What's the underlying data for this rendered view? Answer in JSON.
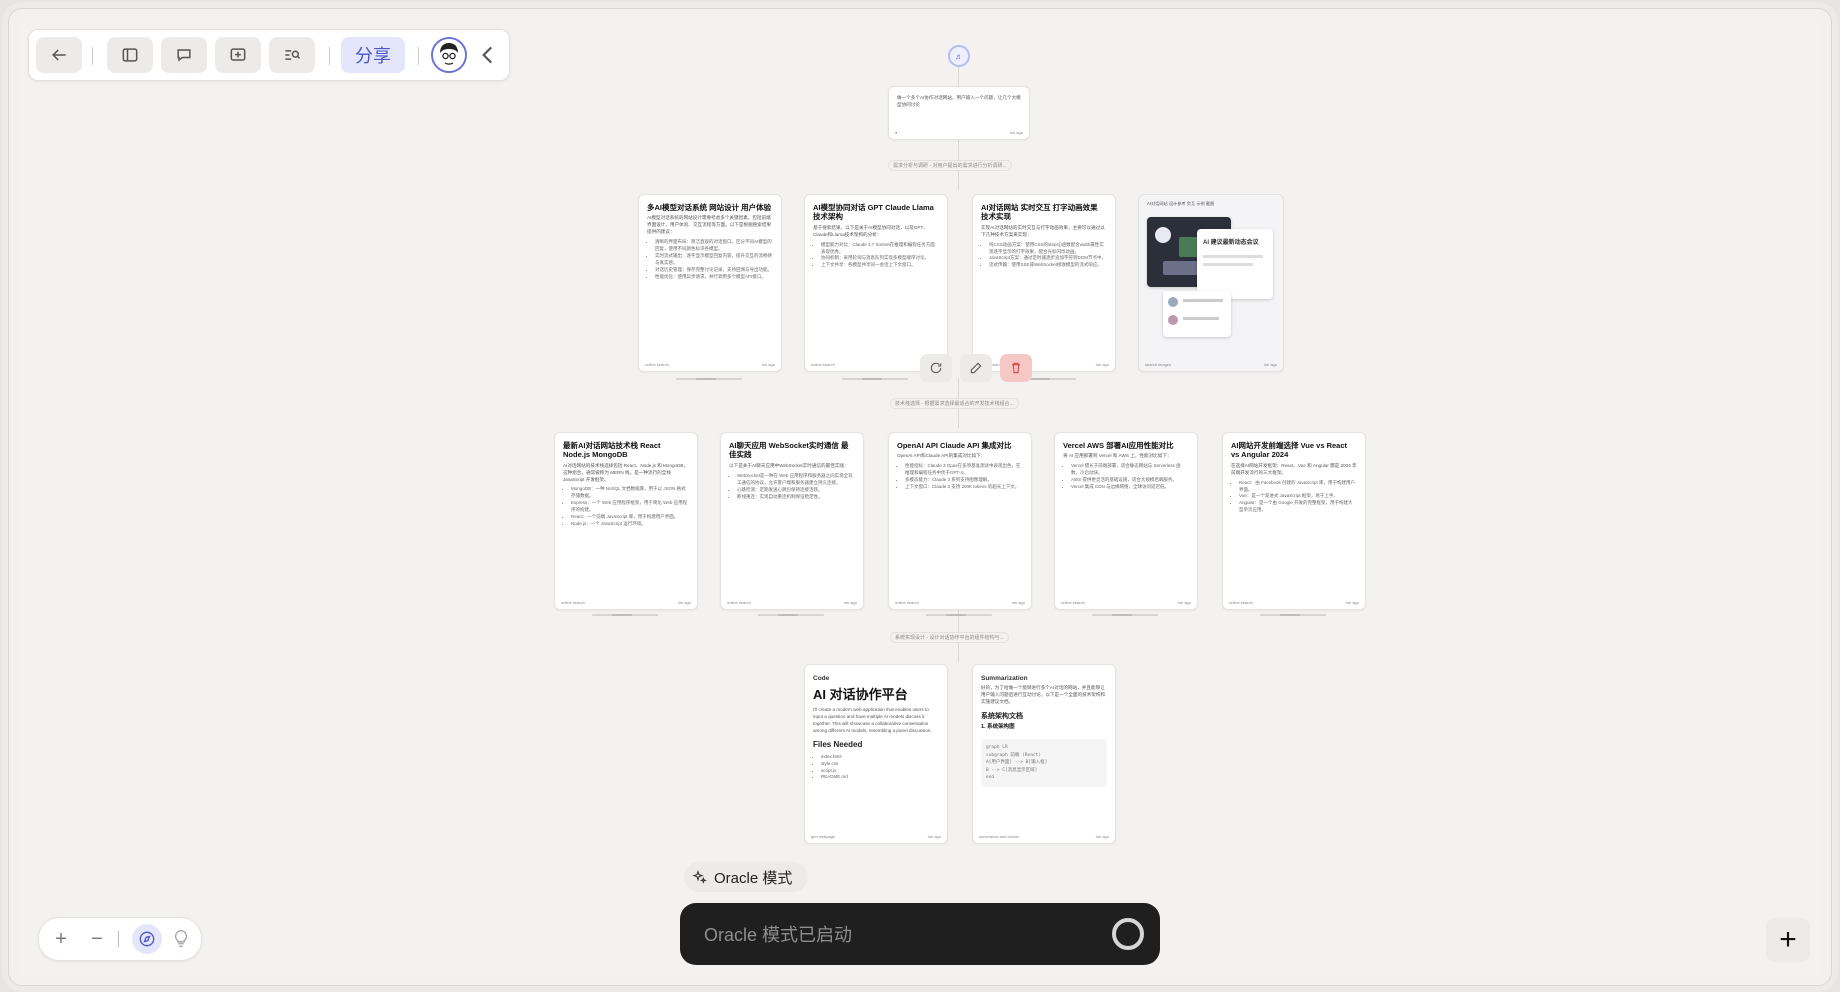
{
  "toolbar": {
    "share_label": "分享"
  },
  "top_node": {
    "label": "♬"
  },
  "root_card": {
    "text": "做一个多个AI协作对话网站，用户输入一个问题，让几个大模型协同讨论",
    "foot_right": "4m ago"
  },
  "edge_labels": {
    "e1": "需求分析与调研 - 对用户提出的需求进行分析调研...",
    "e2": "技术栈选择 - 根据需求选择最适合的开发技术栈组合...",
    "e3": "系统实现设计 - 设计对话协作平台的组件结构与...",
    "image_card_title": "AI对话网站 设计参考 交互 示例 截图"
  },
  "row1": [
    {
      "title": "多AI模型对话系统 网站设计 用户体验",
      "text": "AI模型对话系统的网站设计需要考虑多个关键因素，包括前端界面设计、用户体验、交互流程等方面。以下是根据搜索结果提供的建议：",
      "bullets": [
        "清晰的界面布局：简洁直观的对话窗口，区分不同AI模型的回复，使用不同颜色标识各模型。",
        "实时流式输出：逐字显示模型回复内容，提升交互的流畅感与真实感。",
        "对话历史管理：保存完整讨论记录，支持回溯与导出功能。",
        "性能优化：使用异步请求，并行调用多个模型API接口。"
      ],
      "foot": "online search",
      "foot_right": "4m ago"
    },
    {
      "title": "AI模型协同对话 GPT Claude Llama 技术架构",
      "text": "基于搜索结果，以下是关于AI模型协同对话，以及GPT、Claude和Llama技术架构的分析：",
      "bullets": [
        "模型能力对比：Claude 3.7 Sonnet在推理和编程任务方面表现优秀。",
        "协同机制：采用轮询与消息队列实现多模型顺序讨论。",
        "上下文共享：各模型共享同一会话上下文窗口。"
      ],
      "foot": "online search",
      "foot_right": "4m ago"
    },
    {
      "title": "AI对话网站 实时交互 打字动画效果 技术实现",
      "text": "实现AI对话网站的实时交互与打字动画效果，主要可以通过以下几种技术方案来实现：",
      "bullets": [
        "纯CSS动画方案：使用CSS的steps()函数配合width属性实现逐字显示的打字效果，配合光标闪烁动画。",
        "JavaScript方案：通过定时器逐步追加字符到DOM节点中。",
        "流式传输：使用SSE或WebSocket接收模型的流式响应。"
      ],
      "foot": "online search",
      "foot_right": "4m ago"
    }
  ],
  "image_card": {
    "shot_text": "AI 建议最新动态会议",
    "foot": "search images",
    "foot_right": "4m ago"
  },
  "row2": [
    {
      "title": "最新AI对话网站技术栈 React Node.js MongoDB",
      "text": "AI对话网站的技术栈选择包括 React、Node.js 和 MongoDB，这种组合，通常被称为 MERN 栈，是一种流行的全栈 JavaScript 开发框架。",
      "bullets": [
        "MongoDB：一种 NoSQL 文档数据库，用于以 JSON 格式存储数据。",
        "Express：一个 Web 应用程序框架，用于简化 Web 应用程序的构建。",
        "React：一个前端 JavaScript 库，用于构建用户界面。",
        "Node.js：一个 JavaScript 运行环境。"
      ],
      "foot": "online search",
      "foot_right": "4m ago"
    },
    {
      "title": "AI聊天应用 WebSocket实时通信 最佳实践",
      "text": "以下是关于AI聊天应用中WebSocket实时通信的最佳实践：",
      "bullets": [
        "WebSocket是一种在 Web 应用程序和服务器之间实现全双工通信的协议，允许客户端和服务器建立持久连接。",
        "心跳检测：定期发送心跳包保持连接活跃。",
        "断线重连：实现自动重连机制保证稳定性。"
      ],
      "foot": "online search",
      "foot_right": "4m ago"
    },
    {
      "title": "OpenAI API Claude API 集成对比",
      "text": "OpenAI API和Claude API的集成对比如下：",
      "bullets": [
        "性能指标：Claude 3 Opus在多项基准测试中表现出色，在推理和编程任务中优于GPT-4。",
        "多模态能力：Claude 3 系列支持图像理解。",
        "上下文窗口：Claude 3 支持 200K tokens 的超长上下文。"
      ],
      "foot": "online search",
      "foot_right": "4m ago"
    },
    {
      "title": "Vercel AWS 部署AI应用性能对比",
      "text": "将 AI 应用部署到 Vercel 和 AWS 上，性能对比如下：",
      "bullets": [
        "Vercel 擅长于前端部署，适合静态网站与 Serverless 函数，冷启动快。",
        "AWS 提供更灵活的基础设施，适合大规模后端服务。",
        "Vercel 集成 CDN 与边缘网络，全球访问延迟低。"
      ],
      "foot": "online search",
      "foot_right": "4m ago"
    },
    {
      "title": "AI网站开发前端选择 Vue vs React vs Angular 2024",
      "text": "在选择AI网站开发框架：React、Vue 和 Angular 都是 2024 年前端开发流行的三大框架。",
      "bullets": [
        "React：由 Facebook 创建的 JavaScript 库，用于构建用户界面。",
        "Vue：是一个渐进式 JavaScript 框架，易于上手。",
        "Angular：是一个由 Google 开发的完整框架，用于构建大型单页应用。"
      ],
      "foot": "online search",
      "foot_right": "4m ago"
    }
  ],
  "code_card": {
    "label": "Code",
    "title": "AI 对话协作平台",
    "text": "I'll create a modern web application that enables users to input a question and have multiple AI models discuss it together. This will showcase a collaborative conversation among different AI models, resembling a panel discussion.",
    "files_heading": "Files Needed",
    "files": [
      "index.html",
      "style.css",
      "script.js",
      "README.md"
    ],
    "foot": "gen webpage",
    "foot_right": "4m ago"
  },
  "summary_card": {
    "label": "Summarization",
    "text": "好的，为了给做一个能够进行多个AI对话的网站，并且能够让用户输入问题后进行互动讨论，以下是一个全面的技术架构和实施建议文档。",
    "heading": "系统架构文档",
    "subheading": "1. 系统架构图",
    "code": [
      "graph LR",
      "  subgraph 前端 (React)",
      "    A[用户界面] --> B[输入框]",
      "    B --> C[消息显示区域]",
      "  end"
    ],
    "foot": "summarize and render",
    "foot_right": "4m ago"
  },
  "oracle": {
    "pill_label": "Oracle 模式",
    "input_placeholder": "Oracle 模式已启动"
  },
  "zoom": {
    "plus": "+",
    "minus": "−"
  },
  "fab": {
    "label": "+"
  }
}
